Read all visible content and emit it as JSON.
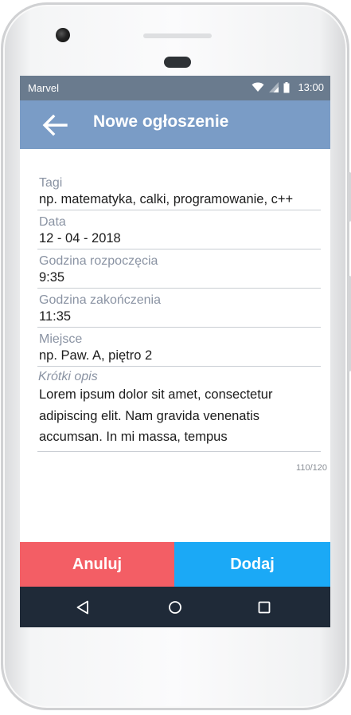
{
  "status_bar": {
    "carrier": "Marvel",
    "time": "13:00"
  },
  "app_bar": {
    "title": "Nowe ogłoszenie"
  },
  "form": {
    "fields": [
      {
        "label": "Tagi",
        "value": "np. matematyka, calki, programowanie, c++"
      },
      {
        "label": "Data",
        "value": "12 - 04 - 2018"
      },
      {
        "label": "Godzina rozpoczęcia",
        "value": "9:35"
      },
      {
        "label": "Godzina zakończenia",
        "value": "11:35"
      },
      {
        "label": "Miejsce",
        "value": "np. Paw. A, piętro 2"
      }
    ],
    "description": {
      "label": "Krótki opis",
      "value": "Lorem ipsum dolor sit amet, consectetur adipiscing elit. Nam gravida venenatis accumsan. In mi massa, tempus",
      "counter": "110/120"
    }
  },
  "buttons": {
    "cancel": "Anuluj",
    "add": "Dodaj"
  },
  "colors": {
    "status_bar": "#6a7b8e",
    "app_bar": "#7a9cc6",
    "cancel": "#f35e65",
    "add": "#1ba9f6",
    "nav_bar": "#1f2a38"
  },
  "icons": {
    "back": "arrow-left-icon",
    "wifi": "wifi-icon",
    "signal": "cell-signal-icon",
    "battery": "battery-icon",
    "nav_back": "triangle-back-icon",
    "nav_home": "circle-home-icon",
    "nav_recents": "square-recents-icon"
  }
}
